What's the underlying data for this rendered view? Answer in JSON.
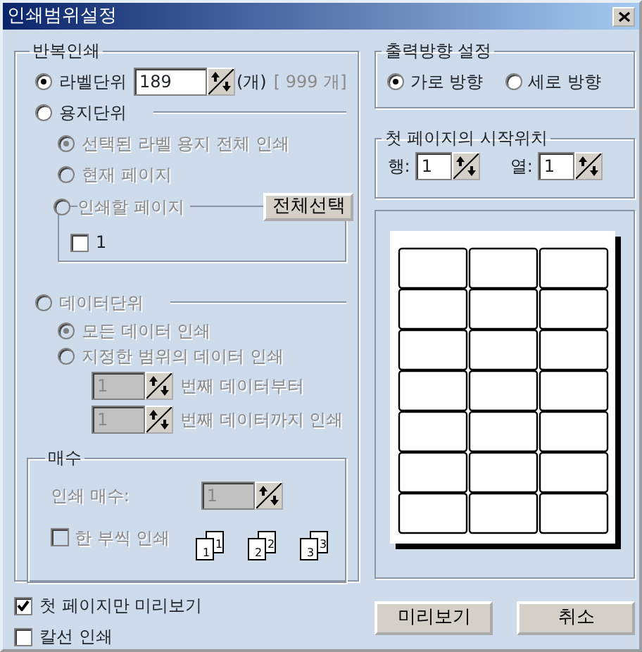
{
  "window": {
    "title": "인쇄범위설정"
  },
  "repeat_print": {
    "title": "반복인쇄",
    "label_unit": {
      "label": "라벨단위",
      "selected": true,
      "value": "189",
      "unit": "(개)",
      "max": "[ 999 개]"
    },
    "paper_unit": {
      "label": "용지단위",
      "selected": false,
      "options": [
        {
          "label": "선택된 라벨 용지 전체 인쇄",
          "selected": true,
          "disabled": true
        },
        {
          "label": "현재 페이지",
          "selected": false,
          "disabled": true
        }
      ],
      "page_option": {
        "label": "인쇄할 페이지",
        "selected": false,
        "disabled": true
      },
      "select_all_button": "전체선택",
      "pages": [
        {
          "label": "1",
          "checked": false
        }
      ]
    },
    "data_unit": {
      "label": "데이터단위",
      "selected": false,
      "disabled": true,
      "options": [
        {
          "label": "모든 데이터 인쇄",
          "selected": true,
          "disabled": true
        },
        {
          "label": "지정한 범위의 데이터 인쇄",
          "selected": false,
          "disabled": true
        }
      ],
      "range": [
        {
          "value": "1",
          "label": "번째 데이터부터",
          "disabled": true
        },
        {
          "value": "1",
          "label": "번째 데이터까지 인쇄",
          "disabled": true
        }
      ]
    },
    "copies": {
      "title": "매수",
      "label": "인쇄 매수:",
      "value": "1",
      "disabled": true,
      "collate": {
        "label": "한 부씩 인쇄",
        "checked": false,
        "disabled": true
      },
      "collate_sets": [
        {
          "front": "1",
          "back": "1"
        },
        {
          "front": "2",
          "back": "2"
        },
        {
          "front": "3",
          "back": "3"
        }
      ]
    }
  },
  "first_page_preview": {
    "label": "첫 페이지만 미리보기",
    "checked": true
  },
  "cut_line": {
    "label": "칼선 인쇄",
    "checked": false
  },
  "orientation": {
    "title": "출력방향 설정",
    "options": [
      {
        "label": "가로 방향",
        "selected": true
      },
      {
        "label": "세로 방향",
        "selected": false
      }
    ]
  },
  "start_position": {
    "title": "첫 페이지의 시작위치",
    "fields": [
      {
        "label": "행:",
        "value": "1"
      },
      {
        "label": "열:",
        "value": "1"
      }
    ]
  },
  "buttons": [
    "미리보기",
    "취소"
  ]
}
